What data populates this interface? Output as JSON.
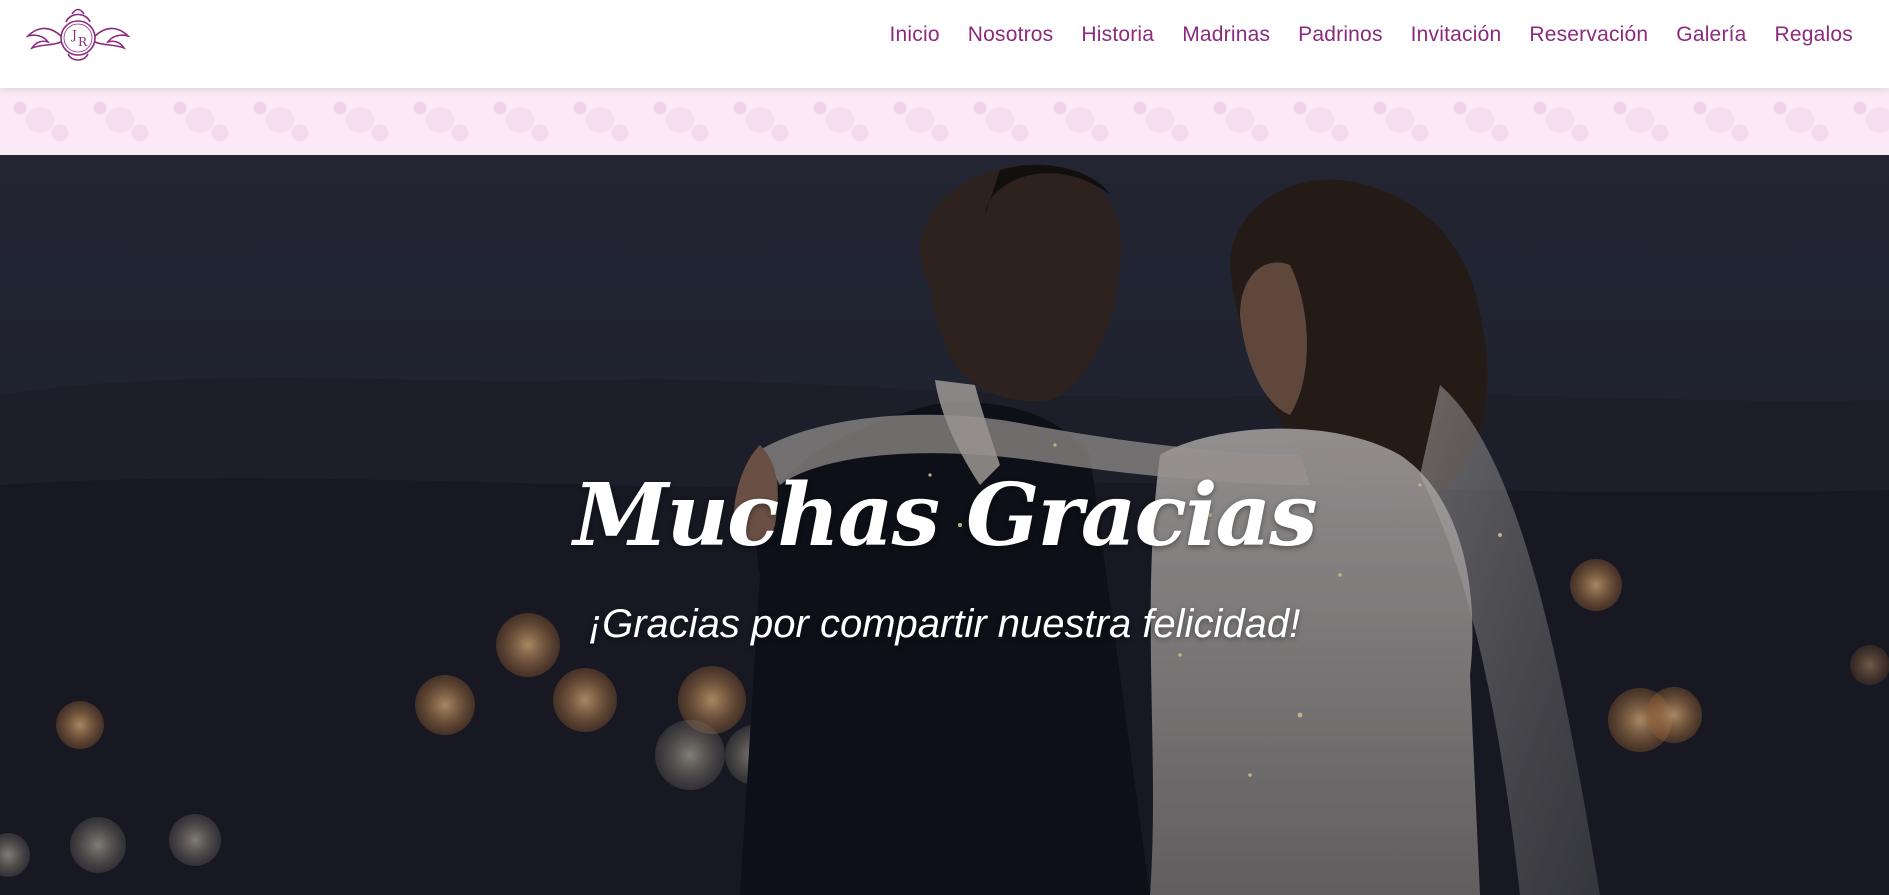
{
  "brand": {
    "monogram_left": "J",
    "monogram_right": "R",
    "accent_color": "#8b2a7e"
  },
  "nav": {
    "items": [
      {
        "label": "Inicio"
      },
      {
        "label": "Nosotros"
      },
      {
        "label": "Historia"
      },
      {
        "label": "Madrinas"
      },
      {
        "label": "Padrinos"
      },
      {
        "label": "Invitación"
      },
      {
        "label": "Reservación"
      },
      {
        "label": "Galería"
      },
      {
        "label": "Regalos"
      }
    ]
  },
  "hero": {
    "title": "Muchas Gracias",
    "subtitle": "¡Gracias por compartir nuestra felicidad!"
  }
}
